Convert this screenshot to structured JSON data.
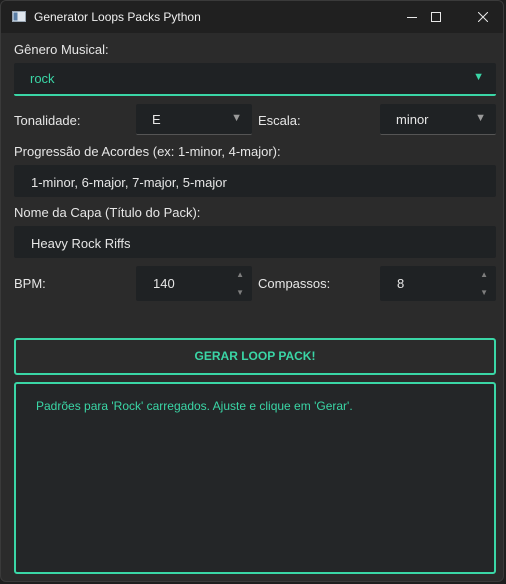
{
  "window": {
    "title": "Generator Loops Packs Python",
    "controls": {
      "minimize": "minimize-icon",
      "maximize": "maximize-icon",
      "close": "close-icon"
    }
  },
  "colors": {
    "accent": "#3ad6a6",
    "background": "#2b2b2b",
    "field": "#1f2224",
    "titlebar": "#202020"
  },
  "genre": {
    "label": "Gênero Musical:",
    "value": "rock"
  },
  "tonality": {
    "label": "Tonalidade:",
    "value": "E"
  },
  "scale": {
    "label": "Escala:",
    "value": "minor"
  },
  "chords": {
    "label": "Progressão de Acordes (ex: 1-minor, 4-major):",
    "value": "1-minor, 6-major, 7-major, 5-major"
  },
  "pack_name": {
    "label": "Nome da Capa (Título do Pack):",
    "value": "Heavy Rock Riffs"
  },
  "bpm": {
    "label": "BPM:",
    "value": "140"
  },
  "bars": {
    "label": "Compassos:",
    "value": "8"
  },
  "generate_button": "GERAR LOOP PACK!",
  "log": {
    "message": "Padrões para 'Rock' carregados. Ajuste e clique em 'Gerar'."
  }
}
